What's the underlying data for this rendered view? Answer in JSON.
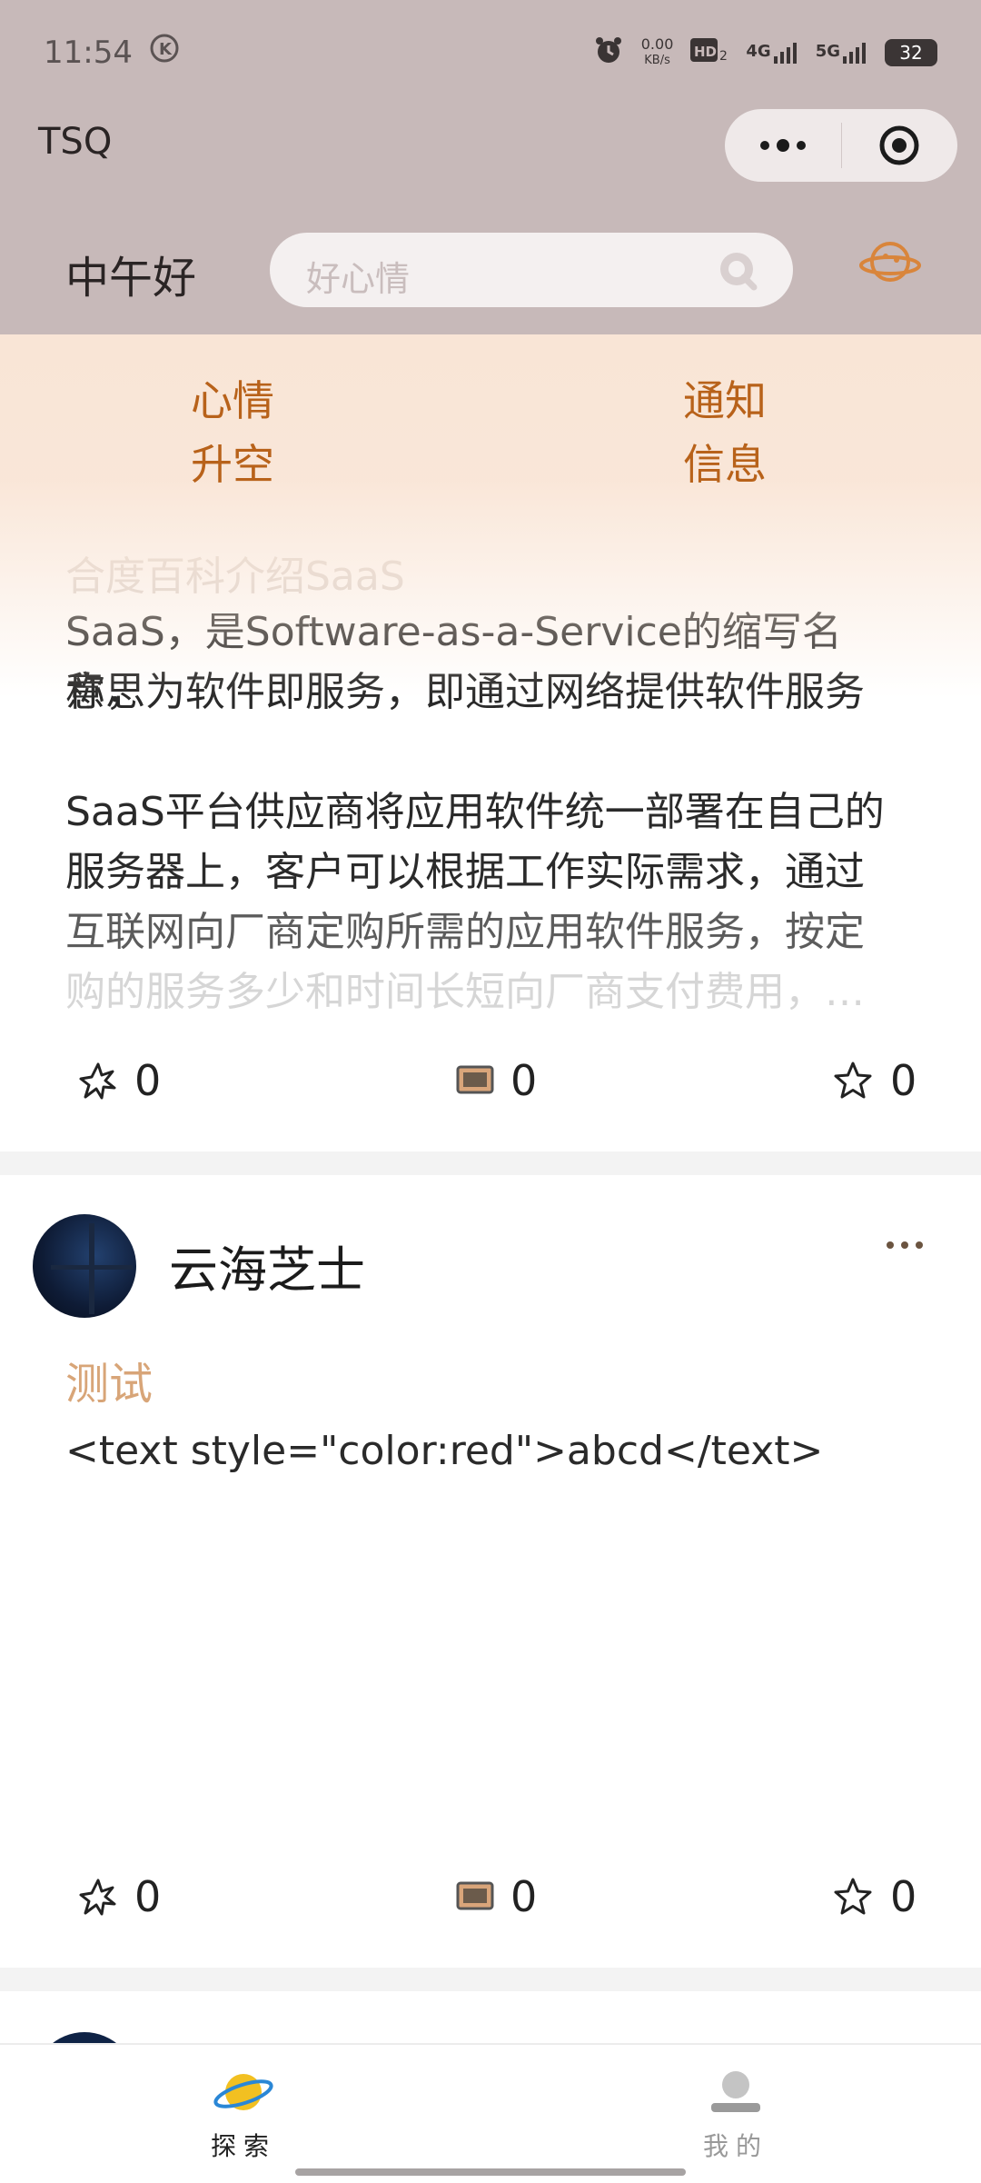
{
  "status_bar": {
    "time": "11:54",
    "speed_value": "0.00",
    "speed_unit": "KB/s",
    "network_4g": "4G",
    "network_5g": "5G",
    "battery": "32"
  },
  "nav": {
    "title": "TSQ"
  },
  "header": {
    "greeting": "中午好",
    "search_placeholder": "好心情"
  },
  "quick_links": [
    {
      "label": "心情\n升空"
    },
    {
      "label": "通知\n信息"
    }
  ],
  "posts": [
    {
      "faded_title": "合度百科介绍SaaS",
      "body_lines": [
        "SaaS，是Software-as-a-Service的缩写名称，",
        "意思为软件即服务，即通过网络提供软件服务",
        "",
        "SaaS平台供应商将应用软件统一部署在自己的",
        "服务器上，客户可以根据工作实际需求，通过",
        "互联网向厂商定购所需的应用软件服务，按定",
        "购的服务多少和时间长短向厂商支付费用，…"
      ],
      "likes": "0",
      "comments": "0",
      "favorites": "0"
    },
    {
      "username": "云海芝士",
      "tag": "测试",
      "body": "<text style=\"color:red\">abcd</text>",
      "likes": "0",
      "comments": "0",
      "favorites": "0"
    }
  ],
  "tabbar": {
    "tabs": [
      {
        "label": "探索",
        "color": "#222222"
      },
      {
        "label": "我的",
        "color": "#999999"
      }
    ]
  },
  "colors": {
    "header_bg": "#c7b9b9",
    "accent_orange": "#b8621a",
    "tag_color": "#d8a578"
  }
}
